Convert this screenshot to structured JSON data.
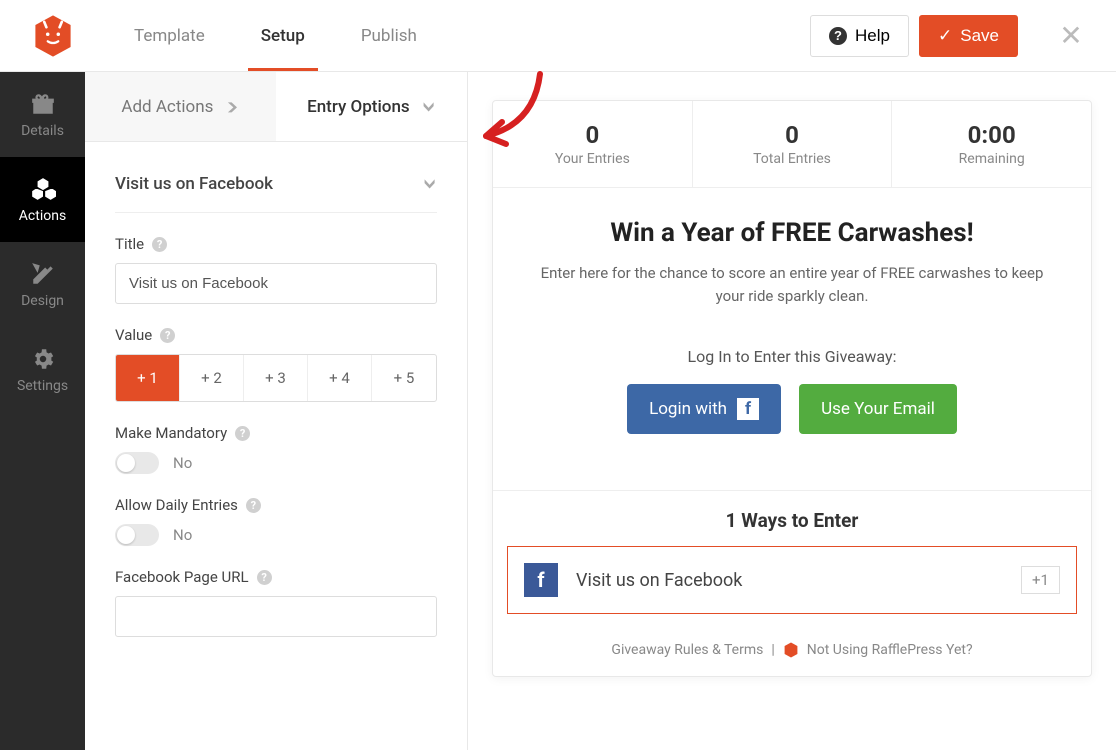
{
  "header": {
    "tabs": {
      "template": "Template",
      "setup": "Setup",
      "publish": "Publish"
    },
    "help": "Help",
    "save": "Save"
  },
  "sidebar": {
    "details": "Details",
    "actions": "Actions",
    "design": "Design",
    "settings": "Settings"
  },
  "editor": {
    "add_actions": "Add Actions",
    "entry_options": "Entry Options",
    "section_title": "Visit us on Facebook",
    "title_label": "Title",
    "title_value": "Visit us on Facebook",
    "value_label": "Value",
    "value_options": [
      "+ 1",
      "+ 2",
      "+ 3",
      "+ 4",
      "+ 5"
    ],
    "value_selected": "+ 1",
    "mandatory_label": "Make Mandatory",
    "mandatory_state": "No",
    "daily_label": "Allow Daily Entries",
    "daily_state": "No",
    "fburl_label": "Facebook Page URL",
    "fburl_value": ""
  },
  "preview": {
    "stats": {
      "your_entries_val": "0",
      "your_entries_lbl": "Your Entries",
      "total_entries_val": "0",
      "total_entries_lbl": "Total Entries",
      "remaining_val": "0:00",
      "remaining_lbl": "Remaining"
    },
    "title": "Win a Year of FREE Carwashes!",
    "desc": "Enter here for the chance to score an entire year of FREE carwashes to keep your ride sparkly clean.",
    "login_prompt": "Log In to Enter this Giveaway:",
    "login_fb": "Login with",
    "login_email": "Use Your Email",
    "ways_title": "1 Ways to Enter",
    "entry_name": "Visit us on Facebook",
    "entry_points": "+1",
    "footer_rules": "Giveaway Rules & Terms",
    "footer_sep": "|",
    "footer_rp": "Not Using RafflePress Yet?"
  },
  "colors": {
    "accent": "#e34d26",
    "fb": "#3b5998",
    "green": "#53ac3f"
  }
}
